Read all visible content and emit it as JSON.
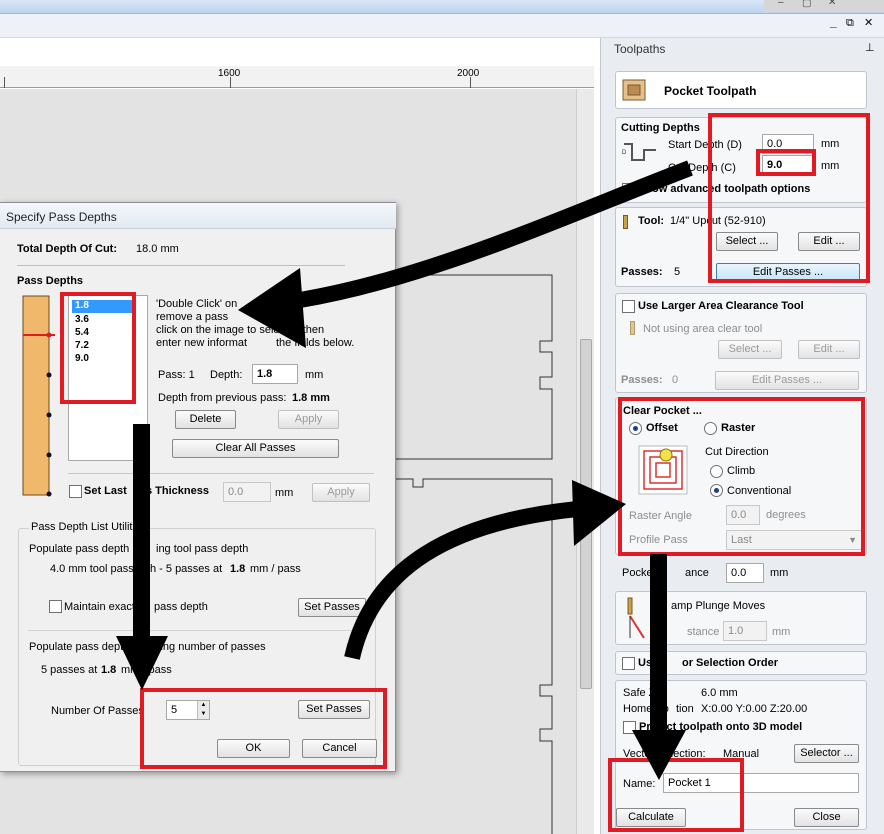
{
  "ruler": {
    "ticks": [
      "1600",
      "2000"
    ]
  },
  "window_controls": {
    "minimize": "_",
    "restore": "⧉",
    "close": "✕"
  },
  "toolpaths_panel": {
    "title": "Toolpaths",
    "pin": "⊥",
    "header_title": "Pocket Toolpath",
    "cutting_depths": {
      "heading": "Cutting Depths",
      "start_label": "Start Depth (D)",
      "start_value": "0.0",
      "cut_label": "Cut Depth (C)",
      "cut_value": "9.0",
      "unit": "mm",
      "show_advanced": "Show advanced toolpath options"
    },
    "tool": {
      "label": "Tool:",
      "name": "1/4\" Upcut (52-910)",
      "select": "Select ...",
      "edit": "Edit ...",
      "passes_label": "Passes:",
      "passes_value": "5",
      "edit_passes": "Edit Passes ..."
    },
    "area_clear": {
      "label": "Use Larger Area Clearance Tool",
      "note": "Not using area clear tool",
      "select": "Select ...",
      "edit": "Edit ...",
      "passes_label": "Passes:",
      "passes_value": "0",
      "edit_passes": "Edit Passes ..."
    },
    "clear_pocket": {
      "heading": "Clear Pocket ...",
      "offset": "Offset",
      "raster": "Raster",
      "cut_direction": "Cut Direction",
      "climb": "Climb",
      "conventional": "Conventional",
      "raster_angle_label": "Raster Angle",
      "raster_angle_value": "0.0",
      "degrees": "degrees",
      "profile_pass_label": "Profile Pass",
      "profile_pass_value": "Last"
    },
    "pocket_allowance": {
      "label_a": "Pocket",
      "label_b": "ance",
      "value": "0.0",
      "unit": "mm"
    },
    "ramp": {
      "label": "amp Plunge Moves",
      "distance_label": "stance",
      "distance_value": "1.0",
      "unit": "mm"
    },
    "selection_order": {
      "label_a": "Us",
      "label_b": "or Selection Order"
    },
    "safe": {
      "safe_z_label": "Safe Z",
      "safe_z_value": "6.0 mm",
      "home_label": "Home Po",
      "home_label_b": "tion",
      "home_value": "X:0.00 Y:0.00 Z:20.00",
      "project_label": "Project toolpath onto 3D model"
    },
    "vector_selection": {
      "label": "Vector Selection:",
      "value": "Manual",
      "button": "Selector ..."
    },
    "name": {
      "label": "Name:",
      "value": "Pocket 1"
    },
    "calculate": "Calculate",
    "close": "Close"
  },
  "dialog": {
    "title": "Specify Pass Depths",
    "total_label": "Total Depth Of Cut:",
    "total_value": "18.0 mm",
    "pass_depths_heading": "Pass Depths",
    "pass_list": [
      "1.8",
      "3.6",
      "5.4",
      "7.2",
      "9.0"
    ],
    "instructions": [
      "'Double Click' on",
      "remove a pass",
      "click on the image to select it, then",
      "enter new informat",
      "the fields below."
    ],
    "pass_label": "Pass: 1",
    "depth_label": "Depth:",
    "depth_value": "1.8",
    "depth_unit": "mm",
    "depth_prev_label": "Depth from previous pass:",
    "depth_prev_value": "1.8 mm",
    "delete": "Delete",
    "apply": "Apply",
    "clear_all": "Clear All Passes",
    "set_last_a": "Set Last",
    "set_last_b": "s Thickness",
    "set_last_value": "0.0",
    "set_last_unit": "mm",
    "set_last_apply": "Apply",
    "utilities_heading": "Pass Depth List Utiliti",
    "populate_tool_a": "Populate pass depth",
    "populate_tool_b": "ing tool pass depth",
    "tool_info_a": "4.0 mm tool pass",
    "tool_info_b": "h - 5 passes at",
    "tool_info_bold": "1.8",
    "tool_info_c": "mm / pass",
    "maintain_a": "Maintain exact",
    "maintain_b": "pass depth",
    "set_passes": "Set Passes",
    "populate_num": "Populate pass depth list using number of passes",
    "num_info_a": "5 passes at",
    "num_info_bold": "1.8",
    "num_info_c": "mm / pass",
    "number_label": "Number Of Passes",
    "number_value": "5",
    "set_passes_2": "Set Passes",
    "ok": "OK",
    "cancel": "Cancel"
  }
}
